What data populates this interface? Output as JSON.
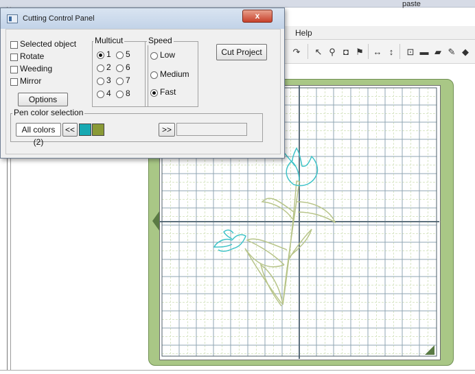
{
  "background_app": {
    "paste_label": "paste",
    "menu": {
      "help_label": "Help"
    },
    "toolbar_icons": [
      "redo-icon",
      "pointer-icon",
      "lasso-icon",
      "eraser-icon",
      "node-icon",
      "flip-horizontal-icon",
      "flip-vertical-icon",
      "group-icon",
      "rectangle-icon",
      "fill-icon",
      "pen-icon"
    ]
  },
  "dialog": {
    "title": "Cutting Control Panel",
    "close_symbol": "x",
    "options": {
      "selected_object": "Selected object",
      "rotate": "Rotate",
      "weeding": "Weeding",
      "mirror": "Mirror",
      "options_button": "Options"
    },
    "multicut": {
      "title": "Multicut",
      "items": [
        "1",
        "2",
        "3",
        "4",
        "5",
        "6",
        "7",
        "8"
      ],
      "selected": "1"
    },
    "speed": {
      "title": "Speed",
      "items": [
        "Low",
        "Medium",
        "Fast"
      ],
      "selected": "Fast"
    },
    "cut_project_button": "Cut Project",
    "pen_color": {
      "title": "Pen color selection",
      "current": "All colors (2)",
      "prev_button": "<<",
      "next_button": ">>",
      "swatch_colors": [
        "#17a9b2",
        "#8a9a36"
      ]
    }
  },
  "colors": {
    "mat_border": "#a9c786",
    "tulip_blue": "#3fc3c8",
    "tulip_green": "#b7c488"
  }
}
